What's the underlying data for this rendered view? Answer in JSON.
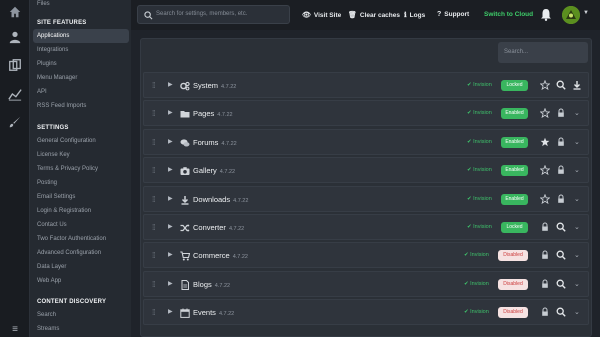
{
  "rail": {
    "icons": [
      "home-icon",
      "users-icon",
      "copy-icon",
      "chart-icon",
      "brush-icon"
    ],
    "menu_glyph": "≡"
  },
  "sidebar": {
    "top_item": "Files",
    "sections": [
      {
        "title": "SITE FEATURES",
        "items": [
          "Applications",
          "Integrations",
          "Plugins",
          "Menu Manager",
          "API",
          "RSS Feed Imports"
        ]
      },
      {
        "title": "SETTINGS",
        "items": [
          "General Configuration",
          "License Key",
          "Terms & Privacy Policy",
          "Posting",
          "Email Settings",
          "Login & Registration",
          "Contact Us",
          "Two Factor Authentication",
          "Advanced Configuration",
          "Data Layer",
          "Web App"
        ]
      },
      {
        "title": "CONTENT DISCOVERY",
        "items": [
          "Search",
          "Streams"
        ]
      }
    ],
    "active_item": "Applications"
  },
  "topbar": {
    "search_placeholder": "Search for settings, members, etc.",
    "links": [
      {
        "label": "Visit Site",
        "glyph": "👁"
      },
      {
        "label": "Clear caches",
        "glyph": "🗑"
      },
      {
        "label": "Logs",
        "glyph": "ℹ"
      },
      {
        "label": "Support",
        "glyph": "?"
      }
    ],
    "switch_label": "Switch to Cloud"
  },
  "filter": {
    "placeholder": "Search..."
  },
  "apps": [
    {
      "name": "System",
      "version": "4.7.22",
      "icon": "cogs-icon",
      "invision": "Invision",
      "status": "Locked",
      "enabled": true,
      "starred": false,
      "actions": [
        "star",
        "search",
        "download"
      ]
    },
    {
      "name": "Pages",
      "version": "4.7.22",
      "icon": "folder-icon",
      "invision": "Invision",
      "status": "Enabled",
      "enabled": true,
      "starred": false,
      "actions": [
        "star",
        "lock",
        "chevron"
      ]
    },
    {
      "name": "Forums",
      "version": "4.7.22",
      "icon": "comments-icon",
      "invision": "Invision",
      "status": "Enabled",
      "enabled": true,
      "starred": true,
      "actions": [
        "star",
        "lock",
        "chevron"
      ]
    },
    {
      "name": "Gallery",
      "version": "4.7.22",
      "icon": "camera-icon",
      "invision": "Invision",
      "status": "Enabled",
      "enabled": true,
      "starred": false,
      "actions": [
        "star",
        "lock",
        "chevron"
      ]
    },
    {
      "name": "Downloads",
      "version": "4.7.22",
      "icon": "download-icon",
      "invision": "Invision",
      "status": "Enabled",
      "enabled": true,
      "starred": false,
      "actions": [
        "star",
        "lock",
        "chevron"
      ]
    },
    {
      "name": "Converter",
      "version": "4.7.22",
      "icon": "shuffle-icon",
      "invision": "Invision",
      "status": "Locked",
      "enabled": true,
      "starred": false,
      "actions": [
        "lock",
        "search",
        "chevron"
      ]
    },
    {
      "name": "Commerce",
      "version": "4.7.22",
      "icon": "cart-icon",
      "invision": "Invision",
      "status": "Disabled",
      "enabled": false,
      "starred": false,
      "actions": [
        "lock",
        "search",
        "chevron"
      ]
    },
    {
      "name": "Blogs",
      "version": "4.7.22",
      "icon": "file-icon",
      "invision": "Invision",
      "status": "Disabled",
      "enabled": false,
      "starred": false,
      "actions": [
        "lock",
        "search",
        "chevron"
      ]
    },
    {
      "name": "Events",
      "version": "4.7.22",
      "icon": "calendar-icon",
      "invision": "Invision",
      "status": "Disabled",
      "enabled": false,
      "starred": false,
      "actions": [
        "lock",
        "search",
        "chevron"
      ]
    }
  ],
  "colors": {
    "accent_green": "#39b65f",
    "disabled_text": "#cc3b3b",
    "disabled_bg": "#f6e2e2"
  }
}
